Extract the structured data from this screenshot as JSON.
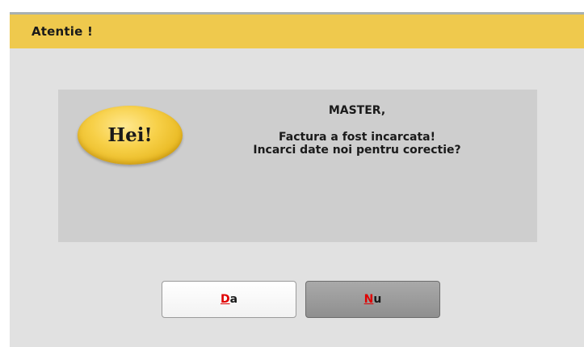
{
  "dialog": {
    "title": "Atentie !"
  },
  "badge": {
    "text": "Hei!"
  },
  "message": {
    "heading": "MASTER,",
    "line1": "Factura a fost incarcata!",
    "line2": "Incarci date noi pentru corectie?"
  },
  "buttons": {
    "yes": {
      "mnemonic": "D",
      "rest": "a"
    },
    "no": {
      "mnemonic": "N",
      "rest": "u"
    }
  },
  "colors": {
    "titlebar": "#efc94d",
    "dialog_bg": "#e1e1e1",
    "panel_bg": "#cecece",
    "mnemonic": "#e00000"
  }
}
